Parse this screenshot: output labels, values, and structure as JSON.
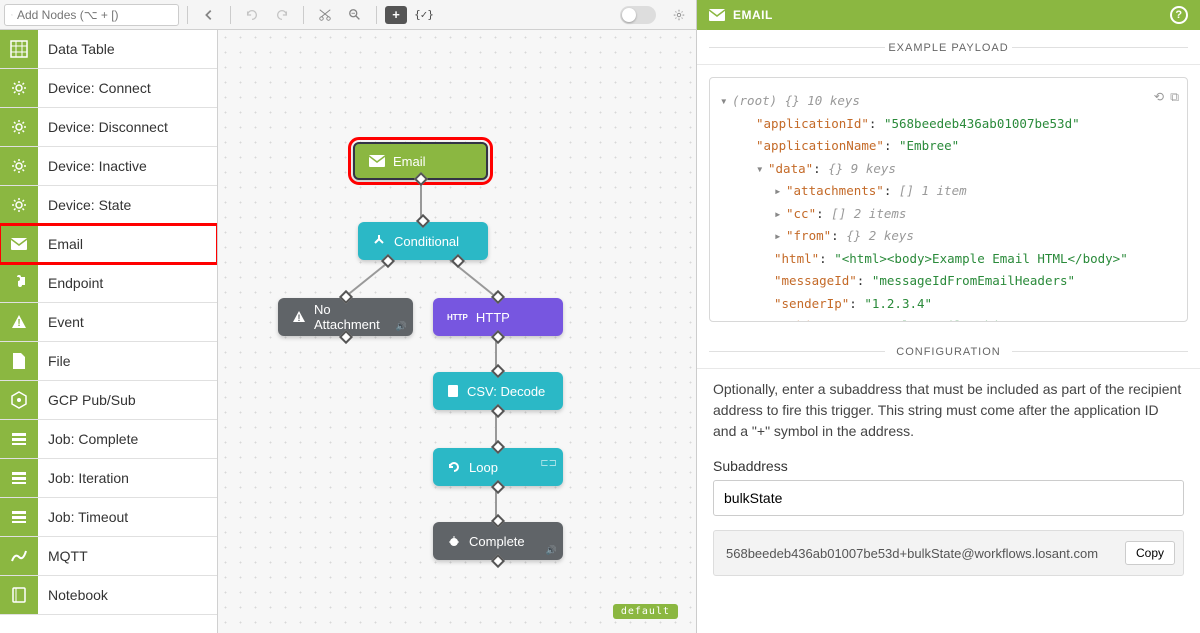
{
  "toolbar": {
    "search_placeholder": "Add Nodes (⌥ + [)"
  },
  "sidebar": {
    "items": [
      {
        "label": "Data Table",
        "icon": "grid"
      },
      {
        "label": "Device: Connect",
        "icon": "gear"
      },
      {
        "label": "Device: Disconnect",
        "icon": "gear"
      },
      {
        "label": "Device: Inactive",
        "icon": "gear"
      },
      {
        "label": "Device: State",
        "icon": "gear"
      },
      {
        "label": "Email",
        "icon": "mail",
        "highlighted": true
      },
      {
        "label": "Endpoint",
        "icon": "puzzle"
      },
      {
        "label": "Event",
        "icon": "warning"
      },
      {
        "label": "File",
        "icon": "file"
      },
      {
        "label": "GCP Pub/Sub",
        "icon": "hex"
      },
      {
        "label": "Job: Complete",
        "icon": "stack"
      },
      {
        "label": "Job: Iteration",
        "icon": "stack"
      },
      {
        "label": "Job: Timeout",
        "icon": "stack"
      },
      {
        "label": "MQTT",
        "icon": "wave"
      },
      {
        "label": "Notebook",
        "icon": "book"
      }
    ]
  },
  "canvas": {
    "default_label": "default",
    "nodes": {
      "email": "Email",
      "conditional": "Conditional",
      "no_attachment": "No Attachment",
      "http": "HTTP",
      "csv_decode": "CSV: Decode",
      "loop": "Loop",
      "complete": "Complete"
    }
  },
  "panel": {
    "title": "EMAIL",
    "sections": {
      "payload": "EXAMPLE PAYLOAD",
      "config": "CONFIGURATION"
    },
    "payload": {
      "root_label": "(root)",
      "root_meta": "{}  10 keys",
      "lines": [
        {
          "key": "applicationId",
          "value": "568beedeb436ab01007be53d",
          "type": "str"
        },
        {
          "key": "applicationName",
          "value": "Embree",
          "type": "str"
        },
        {
          "key": "data",
          "meta": "{}  9 keys",
          "expandable": true
        },
        {
          "key": "attachments",
          "meta": "[]  1 item",
          "child": true
        },
        {
          "key": "cc",
          "meta": "[]  2 items",
          "child": true
        },
        {
          "key": "from",
          "meta": "{}  2 keys",
          "child": true
        },
        {
          "key": "html",
          "value": "<html><body>Example Email HTML</body>",
          "child": true,
          "type": "str"
        },
        {
          "key": "messageId",
          "value": "messageIdFromEmailHeaders",
          "child": true,
          "type": "str"
        },
        {
          "key": "senderIp",
          "value": "1.2.3.4",
          "child": true,
          "type": "str"
        },
        {
          "key": "subject",
          "value": "Example Email Subject",
          "child": true,
          "type": "str",
          "faded": true
        }
      ]
    },
    "config_desc": "Optionally, enter a subaddress that must be included as part of the recipient address to fire this trigger. This string must come after the application ID and a \"+\" symbol in the address.",
    "subaddress_label": "Subaddress",
    "subaddress_value": "bulkState",
    "copy_value": "568beedeb436ab01007be53d+bulkState@workflows.losant.com",
    "copy_button": "Copy"
  }
}
